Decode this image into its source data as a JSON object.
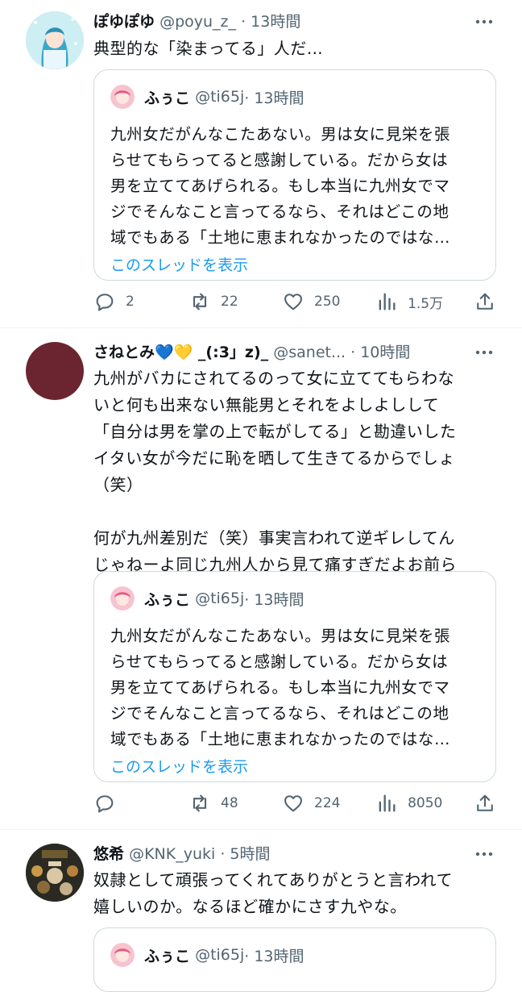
{
  "tweets": [
    {
      "name": "ぽゆぽゆ",
      "handle": "@poyu_z_",
      "time": "· 13時間",
      "text": "典型的な「染まってる」人だ…",
      "quote": {
        "name": "ふぅこ",
        "handle": "@ti65j",
        "time": "· 13時間",
        "lines": [
          "九州女だがんなこたあない。男は女に見栄を張",
          "らせてもらってると感謝している。だから女は",
          "男を立ててあげられる。もし本当に九州女でマ",
          "ジでそんなこと言ってるなら、それはどこの地",
          "域でもある「土地に恵まれなかったのではな…"
        ],
        "link": "このスレッドを表示"
      },
      "actions": {
        "reply": "2",
        "retweet": "22",
        "like": "250",
        "views": "1.5万"
      }
    },
    {
      "name": "さねとみ💙💛 _(:3」z)_",
      "handle": "@sanet...",
      "time": "· 10時間",
      "lines": [
        "九州がバカにされてるのって女に立ててもらわな",
        "いと何も出来ない無能男とそれをよしよしして",
        "「自分は男を掌の上で転がしてる」と勘違いした",
        "イタい女が今だに恥を晒して生きてるからでしょ",
        "（笑）",
        "",
        "何が九州差別だ（笑）事実言われて逆ギレしてん",
        "じゃねーよ同じ九州人から見て痛すぎだよお前ら"
      ],
      "quote": {
        "name": "ふぅこ",
        "handle": "@ti65j",
        "time": "· 13時間",
        "lines": [
          "九州女だがんなこたあない。男は女に見栄を張",
          "らせてもらってると感謝している。だから女は",
          "男を立ててあげられる。もし本当に九州女でマ",
          "ジでそんなこと言ってるなら、それはどこの地",
          "域でもある「土地に恵まれなかったのではな…"
        ],
        "link": "このスレッドを表示"
      },
      "actions": {
        "reply": "",
        "retweet": "48",
        "like": "224",
        "views": "8050"
      }
    },
    {
      "name": "悠希",
      "handle": "@KNK_yuki",
      "time": "· 5時間",
      "lines": [
        "奴隷として頑張ってくれてありがとうと言われて",
        "嬉しいのか。なるほど確かにさす九やな。"
      ],
      "quote": {
        "name": "ふぅこ",
        "handle": "@ti65j",
        "time": "· 13時間"
      }
    }
  ],
  "colors": {
    "accent": "#1d9bf0",
    "muted": "#536471",
    "border": "#cfd9de"
  }
}
